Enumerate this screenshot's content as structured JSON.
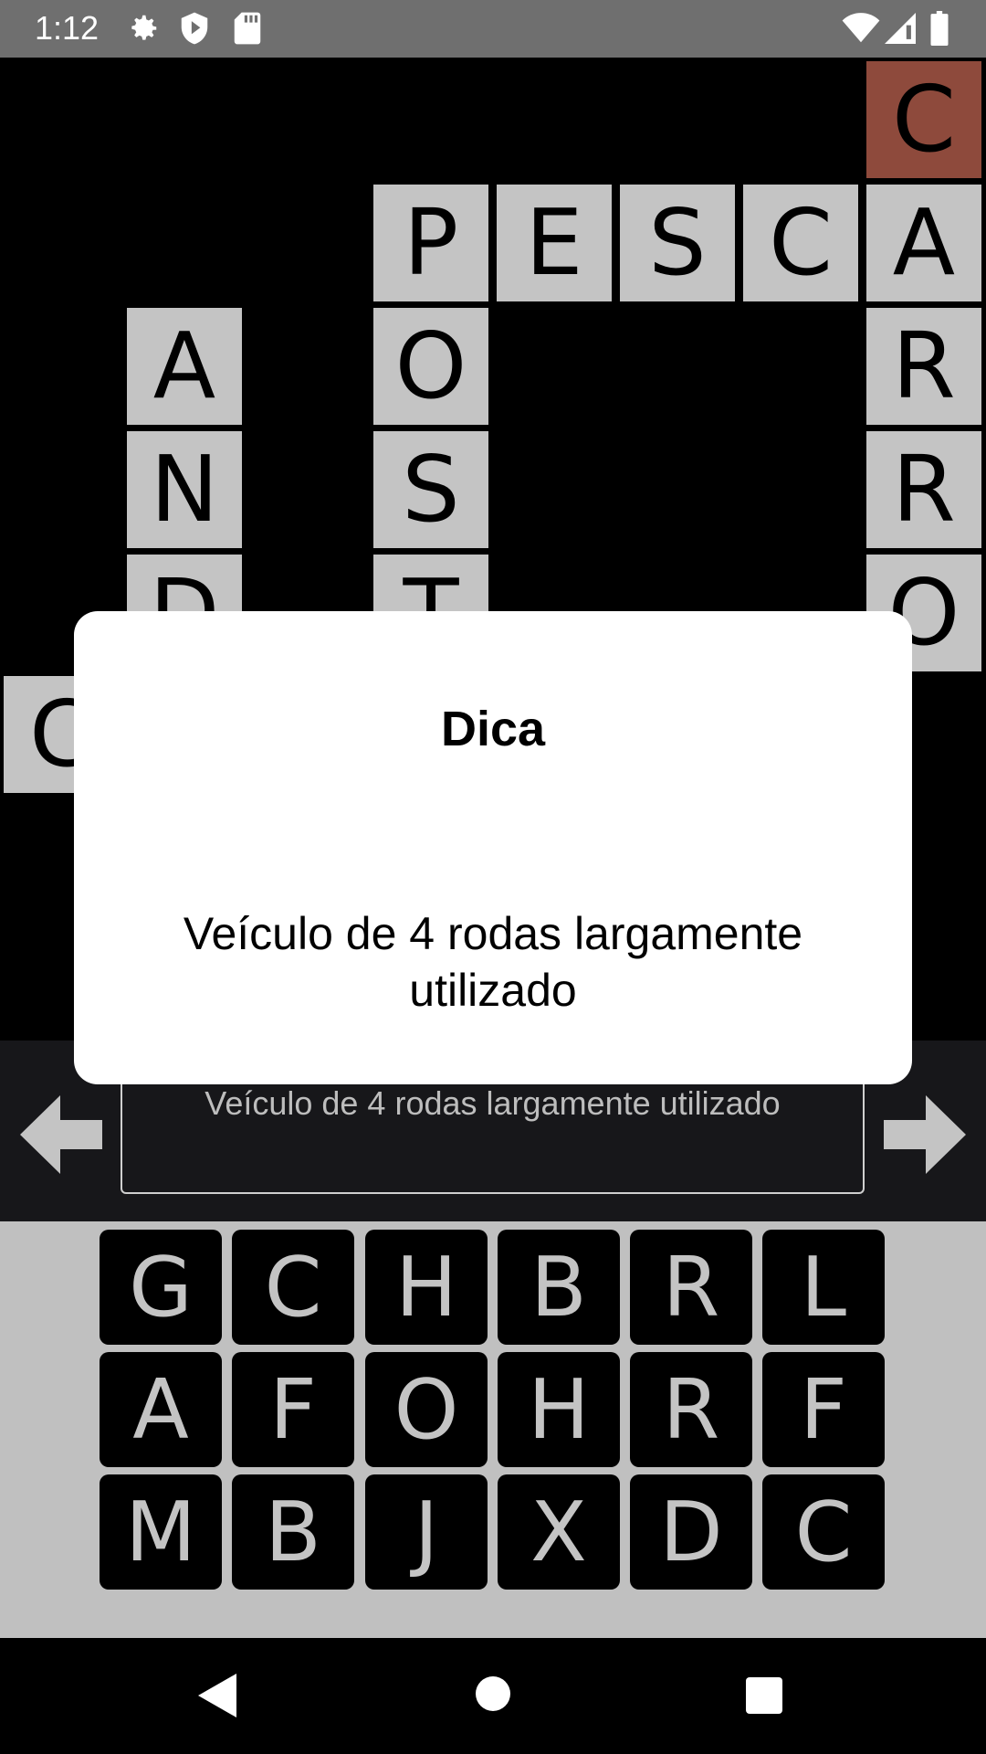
{
  "status_bar": {
    "time": "1:12",
    "left_icons": [
      "settings-icon",
      "shield-play-icon",
      "sd-card-icon"
    ],
    "right_icons": [
      "wifi-icon",
      "signal-icon",
      "battery-icon"
    ]
  },
  "board": {
    "active_color": "#8e4a3c",
    "cell_color": "#c4c4c4",
    "cells": [
      {
        "letter": "C",
        "active": true
      },
      {
        "letter": "P"
      },
      {
        "letter": "E"
      },
      {
        "letter": "S"
      },
      {
        "letter": "C"
      },
      {
        "letter": "A"
      },
      {
        "letter": "A"
      },
      {
        "letter": "O"
      },
      {
        "letter": "R"
      },
      {
        "letter": "N"
      },
      {
        "letter": "S"
      },
      {
        "letter": "R"
      },
      {
        "letter": "D"
      },
      {
        "letter": "T"
      },
      {
        "letter": "O"
      },
      {
        "letter": "C"
      }
    ]
  },
  "hint_bar": {
    "text": "Veículo de 4 rodas largamente utilizado",
    "prev_icon": "arrow-left-icon",
    "next_icon": "arrow-right-icon"
  },
  "keyboard": {
    "rows": [
      [
        "G",
        "C",
        "H",
        "B",
        "R",
        "L"
      ],
      [
        "A",
        "F",
        "O",
        "H",
        "R",
        "F"
      ],
      [
        "M",
        "B",
        "J",
        "X",
        "D",
        "C"
      ]
    ]
  },
  "dialog": {
    "title": "Dica",
    "message": "Veículo de 4 rodas largamente utilizado"
  },
  "nav_bar": {
    "icons": [
      "back-icon",
      "home-icon",
      "recents-icon"
    ]
  }
}
